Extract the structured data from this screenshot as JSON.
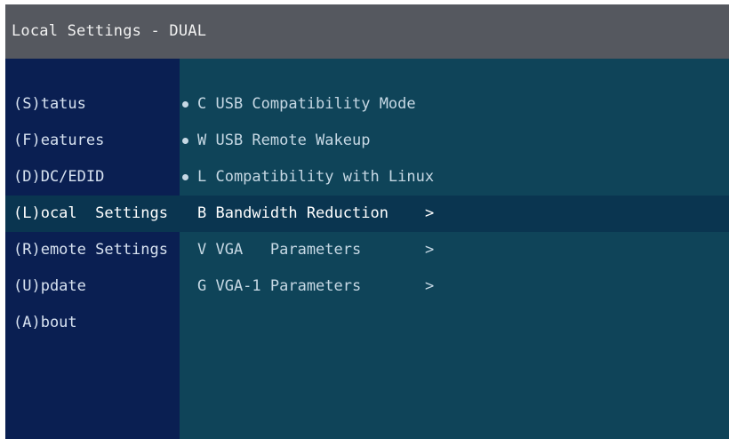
{
  "window": {
    "title": "Local Settings - DUAL"
  },
  "sidebar": {
    "items": [
      {
        "label": "(S)tatus"
      },
      {
        "label": "(F)eatures"
      },
      {
        "label": "(D)DC/EDID"
      },
      {
        "label": "(L)ocal  Settings",
        "active": true
      },
      {
        "label": "(R)emote Settings"
      },
      {
        "label": "(U)pdate"
      },
      {
        "label": "(A)bout"
      }
    ]
  },
  "content": {
    "items": [
      {
        "label": "C USB Compatibility Mode",
        "bullet": true
      },
      {
        "label": "W USB Remote Wakeup",
        "bullet": true
      },
      {
        "label": "L Compatibility with Linux",
        "bullet": true
      },
      {
        "label": "B Bandwidth Reduction",
        "arrow": ">",
        "selected": true
      },
      {
        "label": "V VGA   Parameters",
        "arrow": ">"
      },
      {
        "label": "G VGA-1 Parameters",
        "arrow": ">"
      }
    ]
  },
  "colors": {
    "titlebar": "#55585f",
    "sidebar": "#0a1f52",
    "content": "#0f4459",
    "selected_row": "#0a3550"
  }
}
